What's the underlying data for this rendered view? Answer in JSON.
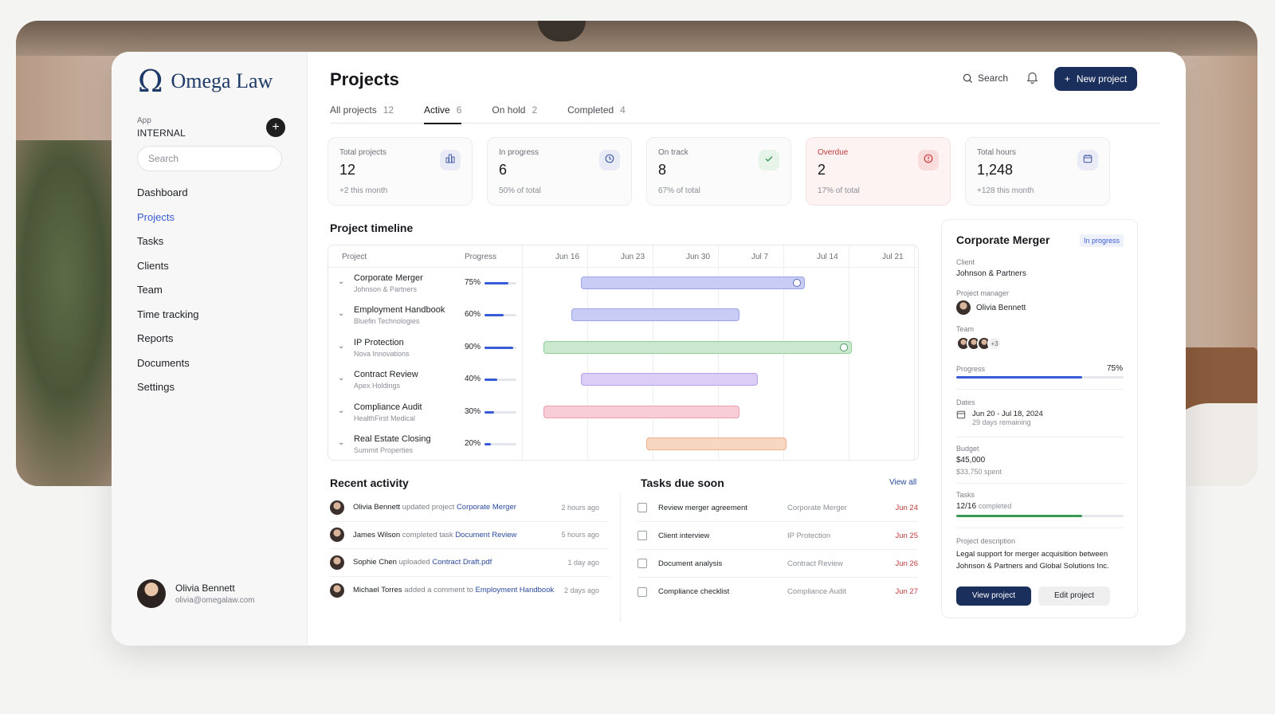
{
  "sidebar": {
    "logo_mark": "Ω",
    "logo_text": "Omega Law",
    "app_label": "App",
    "app_name": "INTERNAL",
    "add_icon": "+",
    "search_placeholder": "Search",
    "nav": [
      "Dashboard",
      "Projects",
      "Tasks",
      "Clients",
      "Team",
      "Time tracking",
      "Reports",
      "Documents",
      "Settings"
    ],
    "active_nav": "Projects",
    "user": {
      "name": "Olivia Bennett",
      "email": "olivia@omegalaw.com"
    }
  },
  "header": {
    "title": "Projects",
    "search_label": "Search",
    "new_button": "New project",
    "new_icon": "+"
  },
  "tabs": [
    {
      "label": "All projects",
      "count": "12"
    },
    {
      "label": "Active",
      "count": "6"
    },
    {
      "label": "On hold",
      "count": "2"
    },
    {
      "label": "Completed",
      "count": "4"
    }
  ],
  "active_tab": "Active",
  "stats": [
    {
      "label": "Total projects",
      "value": "12",
      "sub": "+2 this month",
      "icon": "bar-chart-icon"
    },
    {
      "label": "In progress",
      "value": "6",
      "sub": "50% of total",
      "icon": "clock-icon"
    },
    {
      "label": "On track",
      "value": "8",
      "sub": "67% of total",
      "icon": "check-icon"
    },
    {
      "label": "Overdue",
      "value": "2",
      "sub": "17% of total",
      "icon": "alert-icon"
    },
    {
      "label": "Total hours",
      "value": "1,248",
      "sub": "+128 this month",
      "icon": "calendar-icon"
    }
  ],
  "timeline": {
    "title": "Project timeline",
    "col_project": "Project",
    "col_progress": "Progress",
    "weeks": [
      "Jun 16",
      "Jun 23",
      "Jun 30",
      "Jul 7",
      "Jul 14",
      "Jul 21"
    ],
    "rows": [
      {
        "name": "Corporate Merger",
        "client": "Johnson & Partners",
        "progress": "75%",
        "fraction": 0.75,
        "color": "#c9cdf5",
        "border": "#9aa4e8",
        "start": "Jun 20",
        "end": "Jul 14"
      },
      {
        "name": "Employment Handbook",
        "client": "Bluefin Technologies",
        "progress": "60%",
        "fraction": 0.6,
        "color": "#c9cdf5",
        "border": "#9aa4e8",
        "start": "Jun 19",
        "end": "Jul 7"
      },
      {
        "name": "IP Protection",
        "client": "Nova Innovations",
        "progress": "90%",
        "fraction": 0.9,
        "color": "#cbe9cf",
        "border": "#8fcf9c",
        "start": "Jun 13",
        "end": "Jul 19"
      },
      {
        "name": "Contract Review",
        "client": "Apex Holdings",
        "progress": "40%",
        "fraction": 0.4,
        "color": "#dccdf6",
        "border": "#b7a1ec",
        "start": "Jun 20",
        "end": "Jul 9"
      },
      {
        "name": "Compliance Audit",
        "client": "HealthFirst Medical",
        "progress": "30%",
        "fraction": 0.3,
        "color": "#f8cdd6",
        "border": "#ef9fb0",
        "start": "Jun 13",
        "end": "Jul 7"
      },
      {
        "name": "Real Estate Closing",
        "client": "Summit Properties",
        "progress": "20%",
        "fraction": 0.2,
        "color": "#f8d7c2",
        "border": "#efb08a",
        "start": "Jun 27",
        "end": "Jul 12"
      }
    ]
  },
  "activity": {
    "title": "Recent activity",
    "items": [
      {
        "user": "Olivia Bennett",
        "verb": "updated project",
        "target": "Corporate Merger",
        "time": "2 hours ago"
      },
      {
        "user": "James Wilson",
        "verb": "completed task",
        "target": "Document Review",
        "time": "5 hours ago"
      },
      {
        "user": "Sophie Chen",
        "verb": "uploaded",
        "target": "Contract Draft.pdf",
        "time": "1 day ago"
      },
      {
        "user": "Michael Torres",
        "verb": "added a comment to",
        "target": "Employment Handbook",
        "time": "2 days ago"
      }
    ]
  },
  "tasks": {
    "title": "Tasks due soon",
    "view_all": "View all",
    "items": [
      {
        "name": "Review merger agreement",
        "project": "Corporate Merger",
        "due": "Jun 24"
      },
      {
        "name": "Client interview",
        "project": "IP Protection",
        "due": "Jun 25"
      },
      {
        "name": "Document analysis",
        "project": "Contract Review",
        "due": "Jun 26"
      },
      {
        "name": "Compliance checklist",
        "project": "Compliance Audit",
        "due": "Jun 27"
      }
    ]
  },
  "detail": {
    "title": "Corporate Merger",
    "badge": "In progress",
    "client_label": "Client",
    "client": "Johnson & Partners",
    "pm_label": "Project manager",
    "pm": "Olivia Bennett",
    "team_label": "Team",
    "team_more": "+3",
    "progress_label": "Progress",
    "progress": "75%",
    "progress_fraction": 0.75,
    "dates_label": "Dates",
    "date_start": "Jun 20",
    "date_sep": "-",
    "date_end": "Jul 18, 2024",
    "date_remaining": "29 days remaining",
    "budget_label": "Budget",
    "budget": "$45,000",
    "budget_spent": "$33,750 spent",
    "tasks_label": "Tasks",
    "tasks_done": "12/16",
    "tasks_suffix": "completed",
    "tasks_fraction": 0.75,
    "desc_label": "Project description",
    "desc": "Legal support for merger acquisition between Johnson & Partners and Global Solutions Inc.",
    "view_button": "View project",
    "edit_button": "Edit project"
  }
}
